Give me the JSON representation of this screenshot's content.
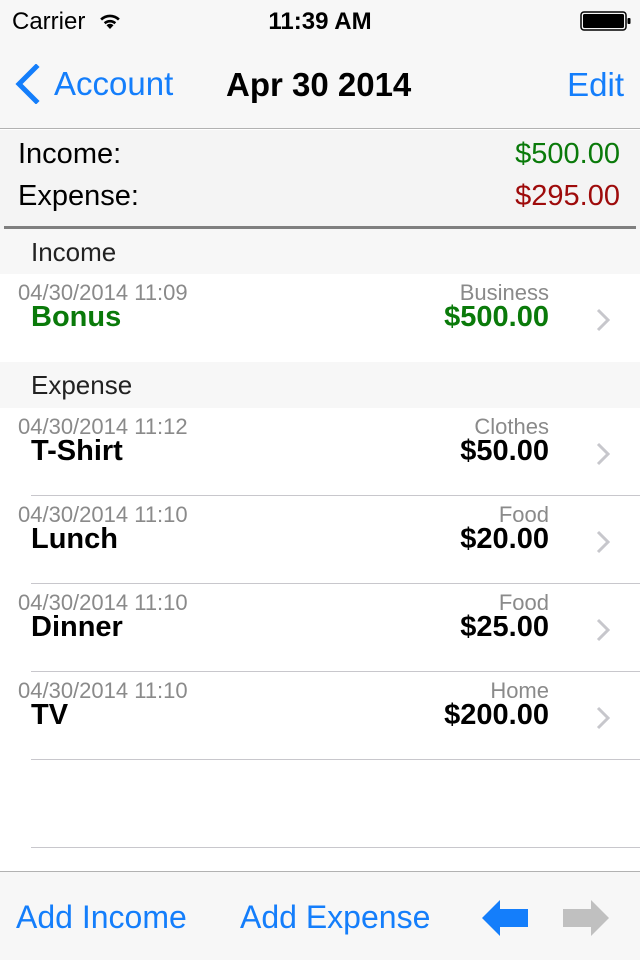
{
  "status_bar": {
    "carrier": "Carrier",
    "time": "11:39 AM",
    "wifi_icon": "wifi-icon",
    "battery_icon": "battery-full-icon"
  },
  "nav": {
    "back_label": "Account",
    "back_icon": "chevron-left-icon",
    "title": "Apr 30 2014",
    "edit_label": "Edit"
  },
  "summary": {
    "income_label": "Income:",
    "income_value": "$500.00",
    "expense_label": "Expense:",
    "expense_value": "$295.00"
  },
  "sections": [
    {
      "title": "Income",
      "rows": [
        {
          "date": "04/30/2014 11:09",
          "category": "Business",
          "name": "Bonus",
          "amount": "$500.00"
        }
      ]
    },
    {
      "title": "Expense",
      "rows": [
        {
          "date": "04/30/2014 11:12",
          "category": "Clothes",
          "name": "T-Shirt",
          "amount": "$50.00"
        },
        {
          "date": "04/30/2014 11:10",
          "category": "Food",
          "name": "Lunch",
          "amount": "$20.00"
        },
        {
          "date": "04/30/2014 11:10",
          "category": "Food",
          "name": "Dinner",
          "amount": "$25.00"
        },
        {
          "date": "04/30/2014 11:10",
          "category": "Home",
          "name": "TV",
          "amount": "$200.00"
        }
      ]
    }
  ],
  "toolbar": {
    "add_income_label": "Add Income",
    "add_expense_label": "Add Expense",
    "prev_icon": "arrow-left-icon",
    "next_icon": "arrow-right-icon",
    "prev_enabled": true,
    "next_enabled": false
  },
  "colors": {
    "accent": "#147efb",
    "income": "#0a7a0a",
    "expense": "#9e0b0b",
    "disabled": "#c0c0c0",
    "chevron": "#c7c7cc"
  }
}
